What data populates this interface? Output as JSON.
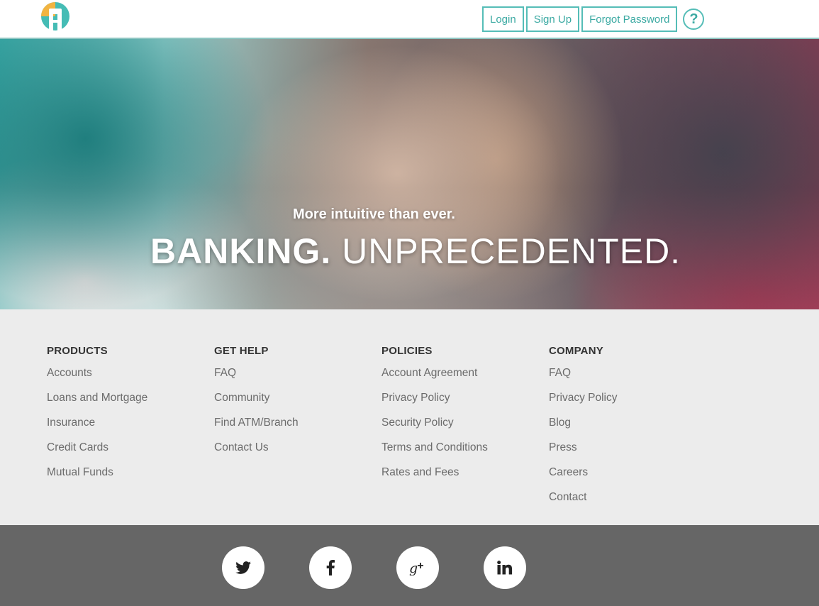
{
  "header": {
    "nav": {
      "login": "Login",
      "signup": "Sign Up",
      "forgot": "Forgot Password",
      "help": "?"
    }
  },
  "hero": {
    "tagline": "More intuitive than ever.",
    "headline_bold": "BANKING.",
    "headline_light": "UNPRECEDENTED."
  },
  "footer": {
    "columns": [
      {
        "heading": "PRODUCTS",
        "links": [
          "Accounts",
          "Loans and Mortgage",
          "Insurance",
          "Credit Cards",
          "Mutual Funds"
        ]
      },
      {
        "heading": "GET HELP",
        "links": [
          "FAQ",
          "Community",
          "Find ATM/Branch",
          "Contact Us"
        ]
      },
      {
        "heading": "POLICIES",
        "links": [
          "Account Agreement",
          "Privacy Policy",
          "Security Policy",
          "Terms and Conditions",
          "Rates and Fees"
        ]
      },
      {
        "heading": "COMPANY",
        "links": [
          "FAQ",
          "Privacy Policy",
          "Blog",
          "Press",
          "Careers",
          "Contact"
        ]
      }
    ]
  },
  "social": {
    "icons": [
      "twitter-icon",
      "facebook-icon",
      "google-plus-icon",
      "linkedin-icon"
    ]
  },
  "colors": {
    "accent": "#55bdb7",
    "footer_bg": "#ececec",
    "social_bg": "#666666"
  }
}
